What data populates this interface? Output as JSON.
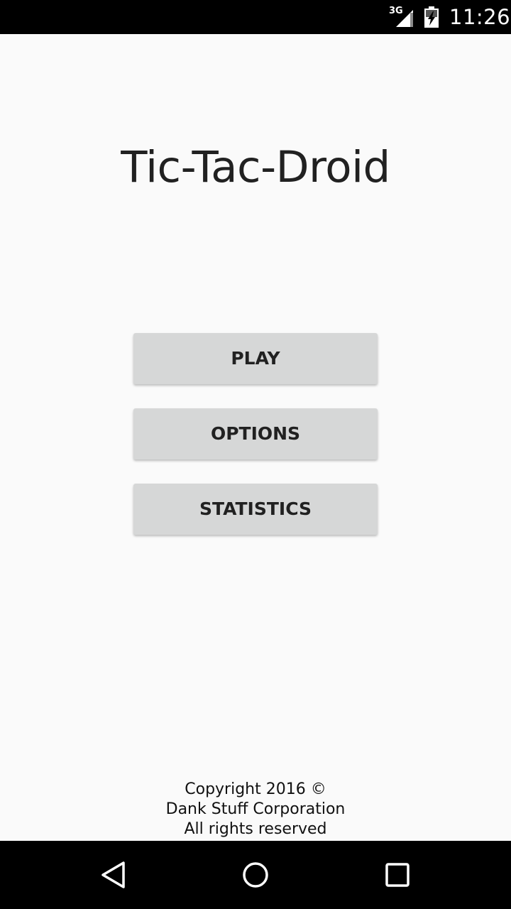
{
  "status_bar": {
    "network": "3G",
    "time": "11:26",
    "icons": [
      "signal-icon",
      "battery-charging-icon"
    ]
  },
  "app": {
    "title": "Tic-Tac-Droid"
  },
  "menu": {
    "play_label": "PLAY",
    "options_label": "OPTIONS",
    "statistics_label": "STATISTICS"
  },
  "footer": {
    "line1": "Copyright 2016 ©",
    "line2": "Dank Stuff Corporation",
    "line3": "All rights reserved"
  },
  "nav_bar": {
    "icons": [
      "back-icon",
      "home-icon",
      "recents-icon"
    ]
  },
  "colors": {
    "background": "#fafafa",
    "button": "#d6d7d7",
    "text": "#212121",
    "bars": "#000000"
  }
}
